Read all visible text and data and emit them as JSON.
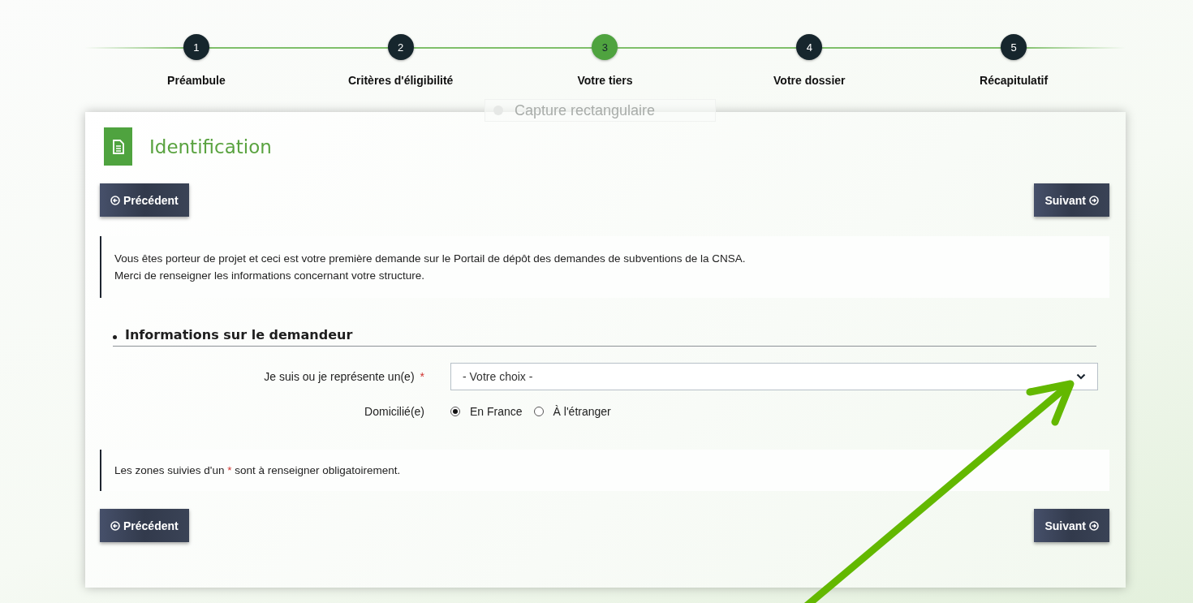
{
  "steps": [
    {
      "number": "1",
      "label": "Préambule",
      "selected": false
    },
    {
      "number": "2",
      "label": "Critères d'éligibilité",
      "selected": false
    },
    {
      "number": "3",
      "label": "Votre tiers",
      "selected": true
    },
    {
      "number": "4",
      "label": "Votre dossier",
      "selected": false
    },
    {
      "number": "5",
      "label": "Récapitulatif",
      "selected": false
    }
  ],
  "overlay_tooltip": {
    "text": "Capture rectangulaire"
  },
  "card": {
    "title": "Identification",
    "top_buttons": {
      "previous": "Précédent",
      "next": "Suivant"
    },
    "intro": [
      "Vous êtes porteur de projet et ceci est votre première demande sur le Portail de dépôt des demandes de subventions de la CNSA.",
      "Merci de renseigner les informations concernant votre structure."
    ],
    "section": {
      "title": "Informations sur le demandeur",
      "fields": [
        {
          "kind": "select",
          "label": "Je suis ou je représente un(e)",
          "required": true,
          "value": "- Votre choix -"
        },
        {
          "kind": "radio",
          "label": "Domicilié(e)",
          "required": false,
          "options": [
            {
              "label": "En France",
              "selected": true
            },
            {
              "label": "À l'étranger",
              "selected": false
            }
          ]
        }
      ]
    },
    "note": {
      "before": "Les zones suivies d'un",
      "mark": "*",
      "after": "sont à renseigner obligatoirement."
    },
    "bottom_buttons": {
      "previous": "Précédent",
      "next": "Suivant"
    }
  },
  "annotation": {
    "kind": "arrow"
  }
}
